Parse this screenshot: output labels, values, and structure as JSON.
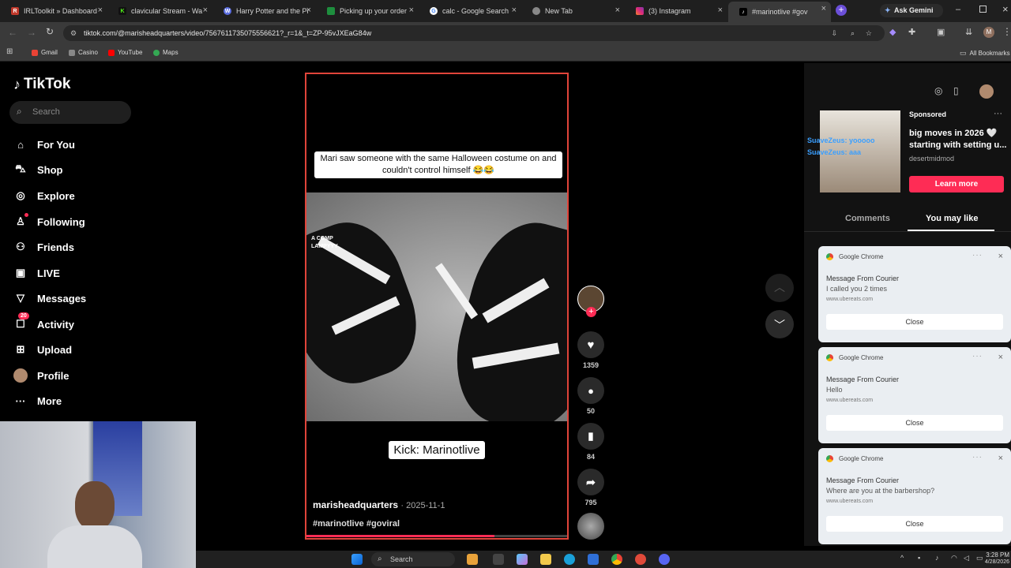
{
  "browser": {
    "tabs": [
      {
        "label": "IRLToolkit » Dashboard",
        "favicon": "irltoolkit-icon",
        "color": "#c0392b"
      },
      {
        "label": "clavicular Stream - Wa",
        "favicon": "kick-icon",
        "color": "#53fc18"
      },
      {
        "label": "Harry Potter and the Pr",
        "favicon": "wordpress-icon",
        "color": "#5b6ee1"
      },
      {
        "label": "Picking up your order",
        "favicon": "sheets-icon",
        "color": "#1e8e3e"
      },
      {
        "label": "calc - Google Search",
        "favicon": "google-icon",
        "color": "#ffffff"
      },
      {
        "label": "New Tab",
        "favicon": "chrome-icon",
        "color": "#aaaaaa"
      },
      {
        "label": "(3) Instagram",
        "favicon": "instagram-icon",
        "color": "#e1306c"
      },
      {
        "label": "#marinotlive #gov",
        "favicon": "tiktok-icon",
        "color": "#ffffff"
      }
    ],
    "ask_gemini": "Ask Gemini",
    "url": "tiktok.com/@marisheadquarters/video/7567611735075556621?_r=1&_t=ZP-95vJXEaG84w",
    "bookmarks": [
      "Gmail",
      "Casino",
      "YouTube",
      "Maps"
    ],
    "all_bookmarks": "All Bookmarks"
  },
  "tiktok": {
    "logo": "TikTok",
    "search_placeholder": "Search",
    "nav": [
      {
        "label": "For You",
        "icon": "home-icon"
      },
      {
        "label": "Shop",
        "icon": "shop-icon"
      },
      {
        "label": "Explore",
        "icon": "compass-icon"
      },
      {
        "label": "Following",
        "icon": "following-icon"
      },
      {
        "label": "Friends",
        "icon": "friends-icon"
      },
      {
        "label": "LIVE",
        "icon": "live-icon"
      },
      {
        "label": "Messages",
        "icon": "messages-icon"
      },
      {
        "label": "Activity",
        "icon": "activity-icon",
        "badge": "20"
      },
      {
        "label": "Upload",
        "icon": "upload-icon"
      },
      {
        "label": "Profile",
        "icon": "profile-avatar"
      },
      {
        "label": "More",
        "icon": "more-icon"
      }
    ],
    "video": {
      "caption": "Mari saw someone with the same Halloween costume on and couldn't control himself 😂😂",
      "overlay_text_top": "A COMP",
      "overlay_text_2": "LAMPYYY",
      "kick_label": "Kick: Marinotlive",
      "author": "marisheadquarters",
      "date": "· 2025-11-1",
      "hashtags": "#marinotlive #goviral",
      "progress": 0.72
    },
    "actions": {
      "likes": "1359",
      "comments": "50",
      "saves": "84",
      "shares": "795"
    }
  },
  "right_panel": {
    "ad": {
      "label": "Sponsored",
      "overlay_1": "SuaveZeus: yooooo",
      "overlay_2": "SuaveZeus: aaa",
      "title": "big moves in 2026 🤍 starting with setting u...",
      "account": "desertmidmod",
      "cta": "Learn more"
    },
    "tabs": [
      "Comments",
      "You may like"
    ]
  },
  "notifications": [
    {
      "app": "Google Chrome",
      "title": "Message From Courier",
      "message": "I called you 2 times",
      "source": "www.ubereats.com",
      "button": "Close"
    },
    {
      "app": "Google Chrome",
      "title": "Message From Courier",
      "message": "Hello",
      "source": "www.ubereats.com",
      "button": "Close"
    },
    {
      "app": "Google Chrome",
      "title": "Message From Courier",
      "message": "Where are you at the barbershop?",
      "source": "www.ubereats.com",
      "button": "Close"
    }
  ],
  "taskbar": {
    "search": "Search",
    "time": "3:28 PM",
    "date": "4/28/2026"
  }
}
